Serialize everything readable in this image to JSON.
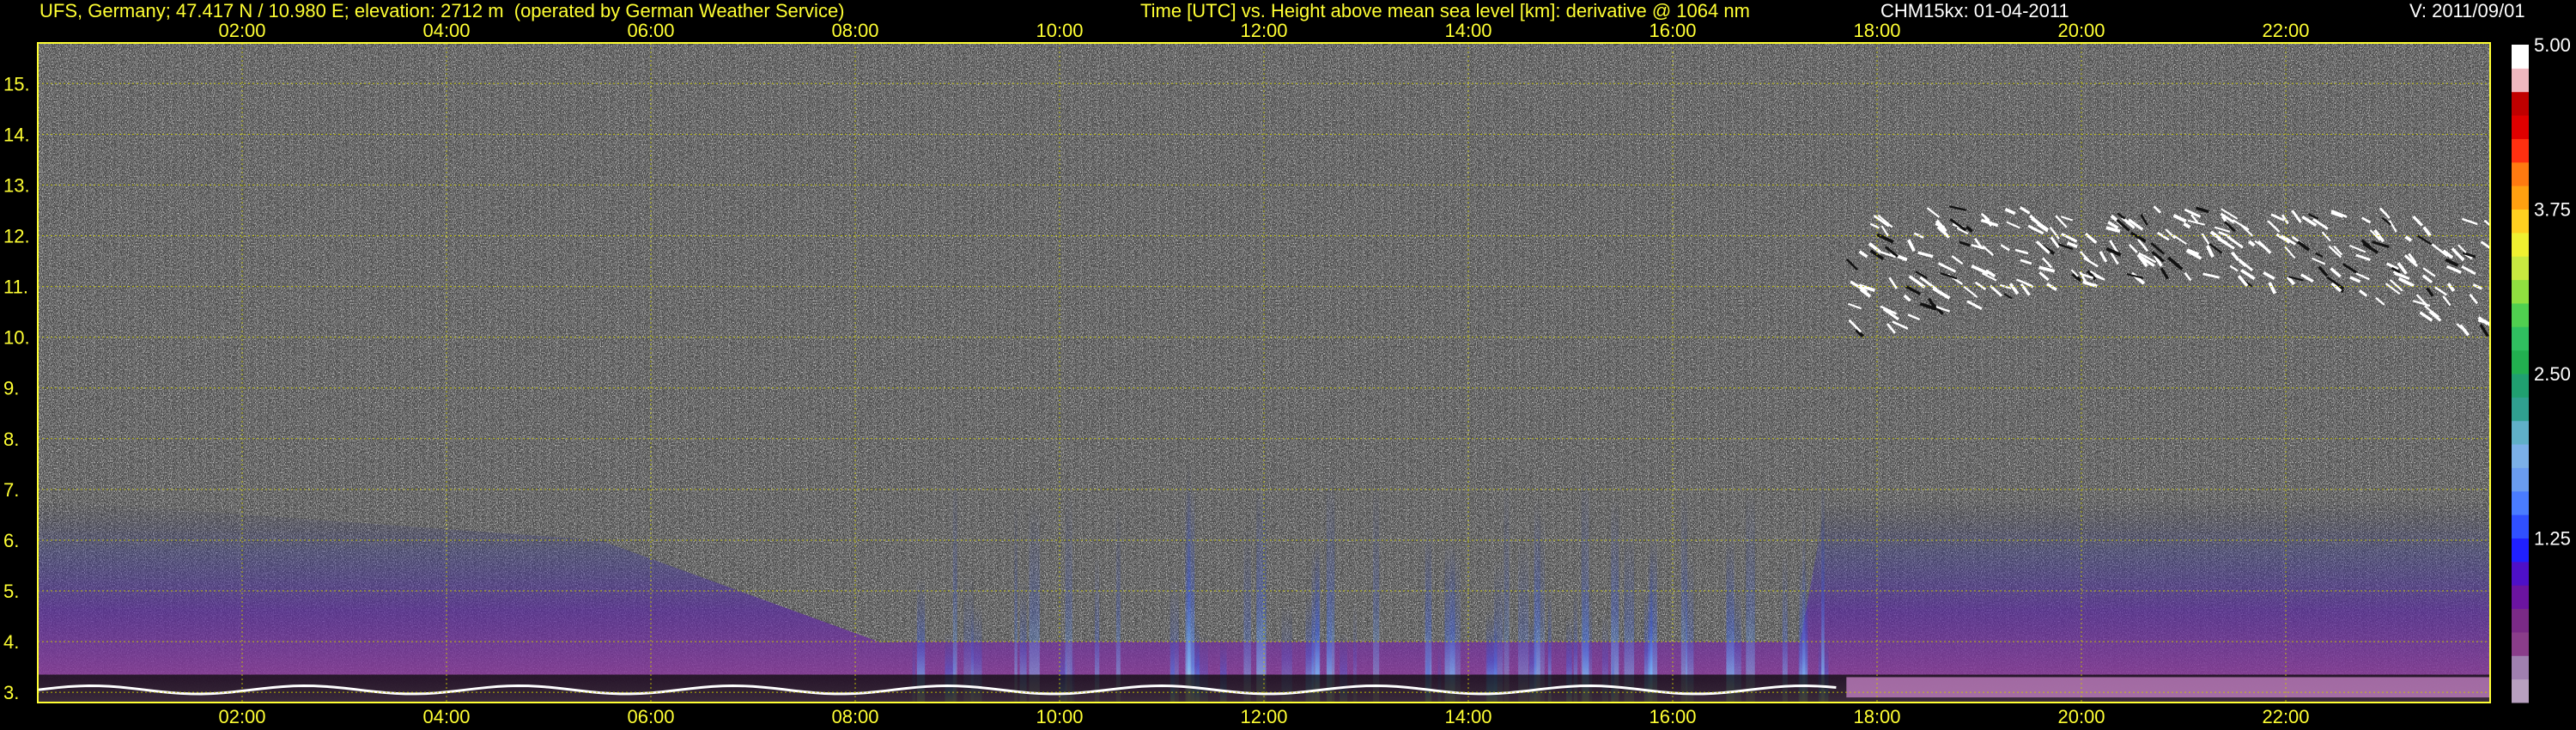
{
  "header": {
    "site": "UFS, Germany; 47.417 N / 10.980 E; elevation: 2712 m  (operated by German Weather Service)",
    "description": "Time [UTC] vs. Height above mean sea level [km]: derivative @ 1064 nm",
    "instrument_date": "CHM15kx: 01-04-2011",
    "version": "V: 2011/09/01"
  },
  "colors": {
    "background": "#000000",
    "grid": "#c8c800",
    "text_yellow": "#ffff33",
    "text_white": "#ffffff"
  },
  "chart_data": {
    "type": "heatmap",
    "title": "Time [UTC] vs. Height above mean sea level [km]: derivative @ 1064 nm",
    "xlabel": "Time [UTC]",
    "ylabel": "Height above mean sea level [km]",
    "x_range_hours": [
      0.0,
      24.0
    ],
    "y_range_km": [
      2.8,
      15.8
    ],
    "x_ticks": [
      "02:00",
      "04:00",
      "06:00",
      "08:00",
      "10:00",
      "12:00",
      "14:00",
      "16:00",
      "18:00",
      "20:00",
      "22:00"
    ],
    "x_tick_hours": [
      2,
      4,
      6,
      8,
      10,
      12,
      14,
      16,
      18,
      20,
      22
    ],
    "y_ticks": [
      "3.",
      "4.",
      "5.",
      "6.",
      "7.",
      "8.",
      "9.",
      "10.",
      "11.",
      "12.",
      "13.",
      "14.",
      "15."
    ],
    "y_tick_values": [
      3,
      4,
      5,
      6,
      7,
      8,
      9,
      10,
      11,
      12,
      13,
      14,
      15
    ],
    "grid": true,
    "colorbar": {
      "min": 0.0,
      "max": 5.0,
      "labels": [
        "5.00",
        "3.75",
        "2.50",
        "1.25"
      ],
      "label_values": [
        5.0,
        3.75,
        2.5,
        1.25
      ],
      "colors": [
        "#b8a0c0",
        "#a080b0",
        "#8a3d8a",
        "#7a2a86",
        "#6b14a0",
        "#4e10c8",
        "#2020ff",
        "#3050ff",
        "#4a7cff",
        "#6a9cf0",
        "#7bb0e8",
        "#60b0c8",
        "#30a090",
        "#20a070",
        "#22b050",
        "#30c060",
        "#50d050",
        "#90e040",
        "#c8e840",
        "#f0f030",
        "#ffd020",
        "#ffa010",
        "#ff7a10",
        "#ff3010",
        "#e00000",
        "#c00000",
        "#f0b8c0",
        "#ffffff"
      ]
    },
    "features": {
      "dust_layer_km": [
        3.0,
        6.8
      ],
      "cloud_hours": [
        17.7,
        24.0
      ],
      "cloud_km": [
        9.6,
        12.6
      ],
      "convective_hours": [
        8.5,
        17.5
      ]
    }
  }
}
